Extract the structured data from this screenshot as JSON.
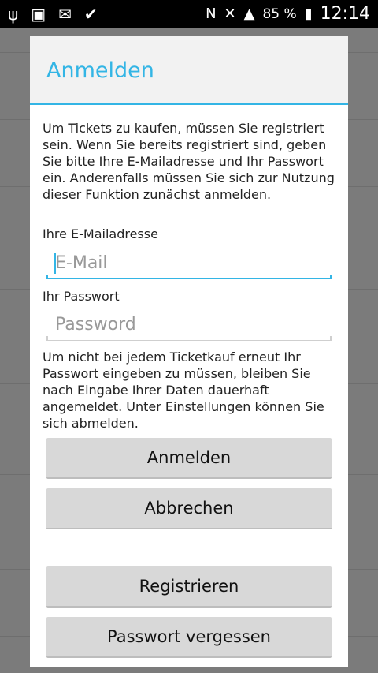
{
  "status_bar": {
    "battery_percent": "85 %",
    "time": "12:14"
  },
  "dialog": {
    "title": "Anmelden",
    "intro_text": "Um Tickets zu kaufen, müssen Sie registriert sein. Wenn Sie bereits registriert sind, geben Sie bitte Ihre E-Mailadresse und Ihr Passwort ein. Anderenfalls müssen Sie sich zur Nutzung dieser Funktion zunächst anmelden.",
    "email_label": "Ihre E-Mailadresse",
    "email_placeholder": "E-Mail",
    "email_value": "",
    "password_label": "Ihr Passwort",
    "password_placeholder": "Password",
    "password_value": "",
    "info_text": "Um nicht bei jedem Ticketkauf erneut Ihr Passwort eingeben zu müssen, bleiben Sie nach Eingabe Ihrer Daten dauerhaft angemeldet. Unter Einstellungen können Sie sich abmelden.",
    "buttons": {
      "login": "Anmelden",
      "cancel": "Abbrechen",
      "register": "Registrieren",
      "forgot_password": "Passwort vergessen"
    }
  },
  "colors": {
    "accent": "#33b5e5",
    "button_bg": "#d8d8d8",
    "dim_background": "#7b7b7b"
  }
}
